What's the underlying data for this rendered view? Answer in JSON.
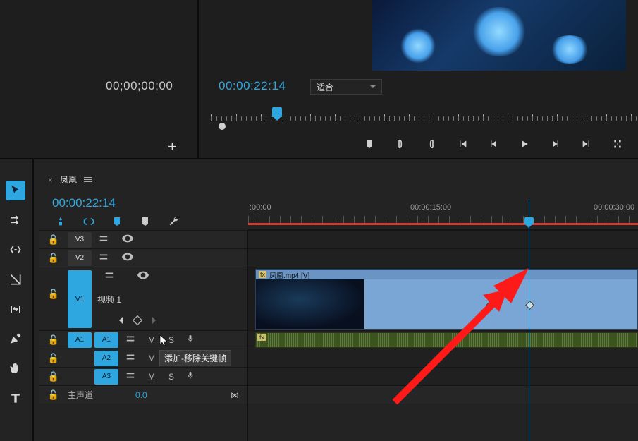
{
  "source": {
    "timecode_left": "00;00;00;00",
    "timecode_right": "00:00:22:14",
    "fit_label": "适合"
  },
  "transport": {
    "marker": "marker",
    "in": "{",
    "out": "}",
    "go_in": "go-to-in",
    "step_back": "step-back",
    "play": "play",
    "step_fwd": "step-fwd",
    "go_out": "go-to-out",
    "loop": "loop"
  },
  "sequence": {
    "close_x": "×",
    "name": "凤凰",
    "timecode": "00:00:22:14"
  },
  "ruler": {
    "labels": [
      ":00:00",
      "00:00:15:00",
      "00:00:30:00"
    ]
  },
  "tracks": {
    "v3": "V3",
    "v2": "V2",
    "v1": "V1",
    "v1_label": "视频 1",
    "a1": "A1",
    "a2": "A2",
    "a3": "A3",
    "m": "M",
    "s": "S",
    "master_label": "主声道",
    "master_value": "0.0"
  },
  "clip": {
    "fx": "fx",
    "name": "凤凰.mp4 [V]"
  },
  "tooltip": {
    "keyframe": "添加-移除关键帧"
  }
}
